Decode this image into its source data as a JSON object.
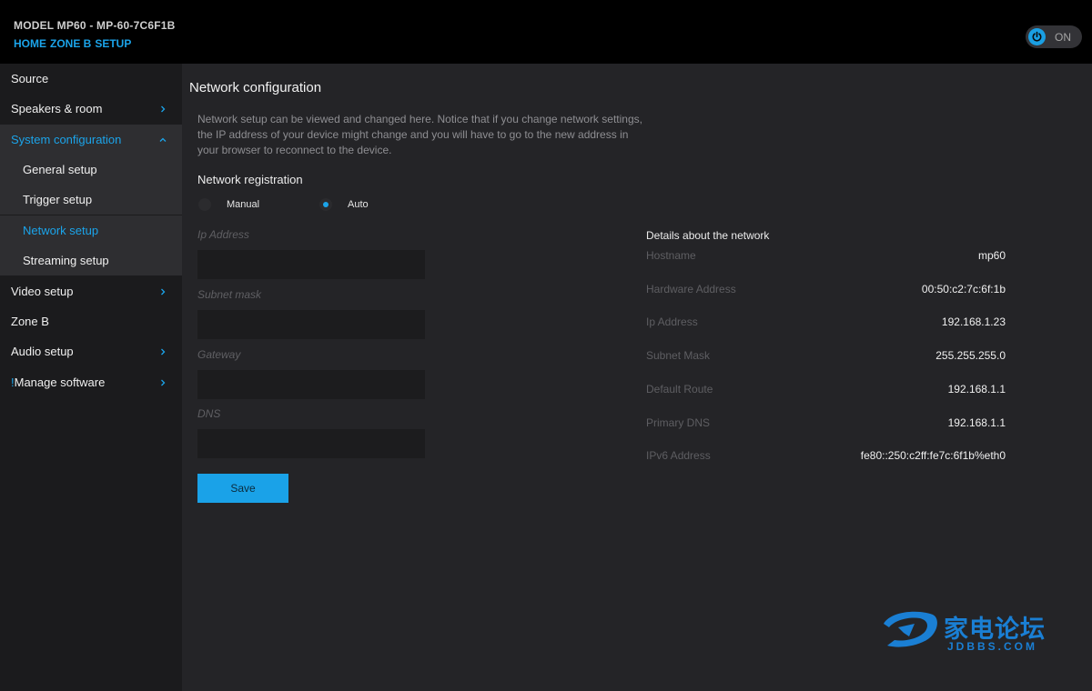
{
  "header": {
    "model": "MODEL MP60 - MP-60-7C6F1B",
    "breadcrumbs": [
      "HOME",
      "ZONE B",
      "SETUP"
    ],
    "power_label": "ON"
  },
  "sidebar": {
    "items": [
      {
        "label": "Source"
      },
      {
        "label": "Speakers & room"
      },
      {
        "label": "System configuration"
      },
      {
        "label": "General setup"
      },
      {
        "label": "Trigger setup"
      },
      {
        "label": "Network setup"
      },
      {
        "label": "Streaming setup"
      },
      {
        "label": "Video setup"
      },
      {
        "label": "Zone B"
      },
      {
        "label": "Audio setup"
      },
      {
        "label": "Manage software",
        "prefix": "!"
      }
    ]
  },
  "main": {
    "title": "Network configuration",
    "intro": "Network setup can be viewed and changed here. Notice that if you change network settings, the IP address of your device might change and you will have to go to the new address in your browser to reconnect to the device.",
    "registration_title": "Network registration",
    "radio_manual": "Manual",
    "radio_auto": "Auto",
    "selected_mode": "Auto",
    "fields": {
      "ip_label": "Ip Address",
      "subnet_label": "Subnet mask",
      "gateway_label": "Gateway",
      "dns_label": "DNS"
    },
    "save_label": "Save"
  },
  "details": {
    "title": "Details about the network",
    "rows": [
      {
        "key": "Hostname",
        "value": "mp60"
      },
      {
        "key": "Hardware Address",
        "value": "00:50:c2:7c:6f:1b"
      },
      {
        "key": "Ip Address",
        "value": "192.168.1.23"
      },
      {
        "key": "Subnet Mask",
        "value": "255.255.255.0"
      },
      {
        "key": "Default Route",
        "value": "192.168.1.1"
      },
      {
        "key": "Primary DNS",
        "value": "192.168.1.1"
      },
      {
        "key": "IPv6 Address",
        "value": "fe80::250:c2ff:fe7c:6f1b%eth0"
      }
    ]
  },
  "watermark": {
    "cn": "家电论坛",
    "en": "JDBBS.COM"
  },
  "colors": {
    "accent": "#1ba4ea",
    "header_bg": "#000000",
    "sidebar_bg": "#1b1b1d",
    "main_bg": "#242427"
  }
}
